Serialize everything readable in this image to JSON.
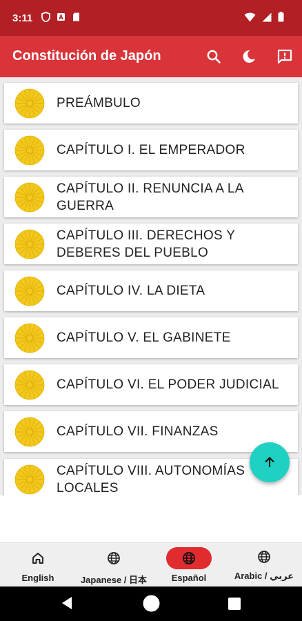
{
  "status_bar": {
    "time": "3:11"
  },
  "app_bar": {
    "title": "Constitución de Japón",
    "actions": [
      {
        "name": "search-button",
        "icon": "search-icon"
      },
      {
        "name": "dark-mode-button",
        "icon": "moon-icon"
      },
      {
        "name": "feedback-button",
        "icon": "feedback-icon"
      }
    ]
  },
  "chapters": [
    {
      "label": "PREÁMBULO"
    },
    {
      "label": "CAPÍTULO I. EL EMPERADOR"
    },
    {
      "label": "CAPÍTULO II. RENUNCIA A LA GUERRA"
    },
    {
      "label": "CAPÍTULO III. DERECHOS Y DEBERES DEL PUEBLO"
    },
    {
      "label": "CAPÍTULO IV. LA DIETA"
    },
    {
      "label": "CAPÍTULO V. EL GABINETE"
    },
    {
      "label": "CAPÍTULO VI. EL PODER JUDICIAL"
    },
    {
      "label": "CAPÍTULO VII. FINANZAS"
    },
    {
      "label": "CAPÍTULO VIII. AUTONOMÍAS LOCALES"
    }
  ],
  "fab": {
    "icon": "arrow-up-icon"
  },
  "bottom_nav": {
    "items": [
      {
        "label": "English",
        "icon": "home-icon",
        "active": false
      },
      {
        "label": "Japanese / 日本",
        "icon": "globe-icon",
        "active": false
      },
      {
        "label": "Español",
        "icon": "globe-icon",
        "active": true
      },
      {
        "label": "Arabic / عربي",
        "icon": "globe-icon",
        "active": false
      }
    ]
  },
  "colors": {
    "status_bar": "#b21f24",
    "app_bar": "#d8343a",
    "active_nav": "#e02b2f",
    "fab": "#1fd1c2",
    "emblem": "#f2c81d"
  }
}
